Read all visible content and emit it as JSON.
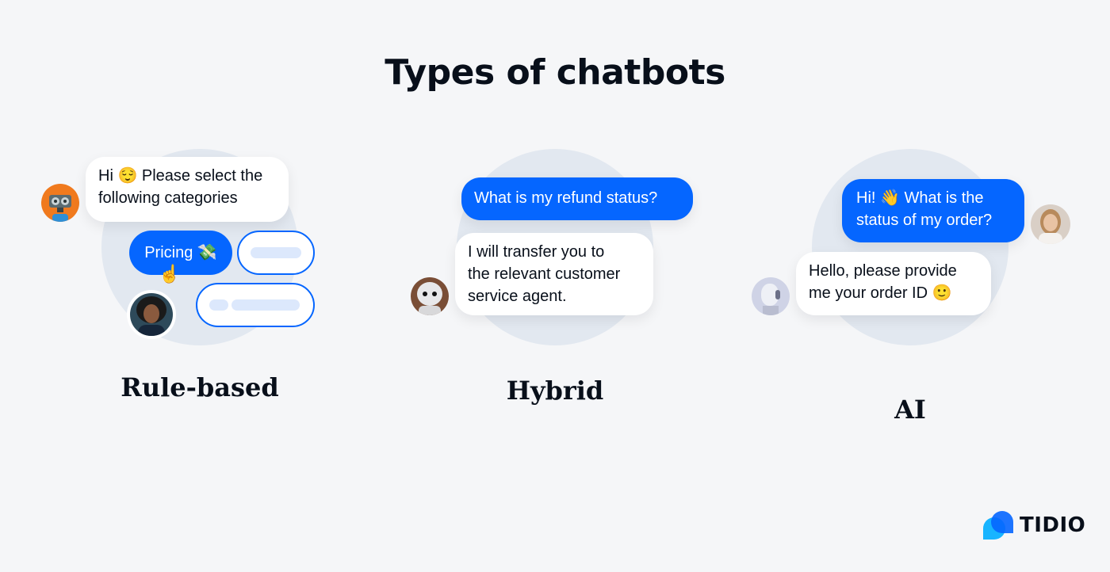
{
  "title": "Types of chatbots",
  "panels": [
    {
      "label": "Rule-based",
      "bot_message": "Hi 😌 Please select the following categories",
      "bot_message_line1": "Hi 😌 Please select the",
      "bot_message_line2": "following categories",
      "option_selected": "Pricing 💸",
      "bot_avatar": "robot-avatar",
      "user_avatar": "woman-avatar"
    },
    {
      "label": "Hybrid",
      "user_message": "What is my refund status?",
      "bot_message_line1": "I will transfer you to",
      "bot_message_line2": "the relevant customer",
      "bot_message_line3": "service agent.",
      "bot_avatar": "pepper-robot-avatar"
    },
    {
      "label": "AI",
      "user_message_line1": "Hi! 👋 What is the",
      "user_message_line2": "status of my order?",
      "bot_message_line1": "Hello, please provide",
      "bot_message_line2": "me your order ID 🙂",
      "bot_avatar": "ai-robot-avatar",
      "user_avatar": "woman-avatar"
    }
  ],
  "brand": {
    "name": "TIDIO",
    "primary_color": "#0566ff",
    "secondary_color": "#18b4ff"
  }
}
